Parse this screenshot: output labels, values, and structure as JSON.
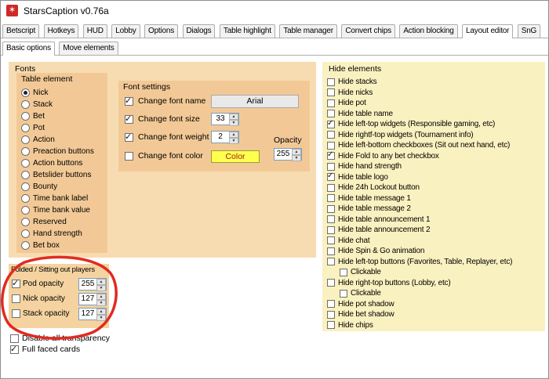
{
  "window": {
    "title": "StarsCaption v0.76a",
    "icon": "starscaption-logo"
  },
  "colors": {
    "panel_peach": "#f7dcb2",
    "group_peach": "#f2c996",
    "hide_panel_yellow": "#faf1c0",
    "annotation_red": "#e02b20",
    "color_button_yellow": "#ffff4d",
    "color_button_text": "#a02020",
    "app_icon_red": "#cf2a27"
  },
  "tabs": {
    "items": [
      {
        "label": "Betscript"
      },
      {
        "label": "Hotkeys"
      },
      {
        "label": "HUD"
      },
      {
        "label": "Lobby"
      },
      {
        "label": "Options"
      },
      {
        "label": "Dialogs"
      },
      {
        "label": "Table highlight"
      },
      {
        "label": "Table manager"
      },
      {
        "label": "Convert chips"
      },
      {
        "label": "Action blocking"
      },
      {
        "label": "Layout editor",
        "active": true
      },
      {
        "label": "SnG"
      }
    ]
  },
  "subtabs": {
    "items": [
      {
        "label": "Basic options",
        "active": true
      },
      {
        "label": "Move elements"
      }
    ]
  },
  "fonts": {
    "title": "Fonts",
    "table_element": {
      "title": "Table element",
      "options": [
        {
          "label": "Nick",
          "selected": true
        },
        {
          "label": "Stack"
        },
        {
          "label": "Bet"
        },
        {
          "label": "Pot"
        },
        {
          "label": "Action"
        },
        {
          "label": "Preaction buttons"
        },
        {
          "label": "Action buttons"
        },
        {
          "label": "Betslider buttons"
        },
        {
          "label": "Bounty"
        },
        {
          "label": "Time bank label"
        },
        {
          "label": "Time bank value"
        },
        {
          "label": "Reserved"
        },
        {
          "label": "Hand strength"
        },
        {
          "label": "Bet box"
        }
      ]
    },
    "font_settings": {
      "title": "Font settings",
      "change_font_name": {
        "label": "Change font name",
        "checked": true,
        "value": "Arial"
      },
      "change_font_size": {
        "label": "Change font size",
        "checked": true,
        "value": "33"
      },
      "change_font_weight": {
        "label": "Change font weight",
        "checked": true,
        "value": "2"
      },
      "change_font_color": {
        "label": "Change font color",
        "checked": false,
        "button": "Color"
      },
      "opacity_label": "Opacity",
      "opacity_value": "255"
    }
  },
  "folded_group": {
    "title": "Folded / Sitting out players",
    "rows": [
      {
        "label": "Pod opacity",
        "checked": true,
        "value": "255"
      },
      {
        "label": "Nick opacity",
        "checked": false,
        "value": "127"
      },
      {
        "label": "Stack opacity",
        "checked": false,
        "value": "127"
      }
    ]
  },
  "bottom_checkboxes": {
    "items": [
      {
        "label": "Disable all transparency",
        "checked": false
      },
      {
        "label": "Full faced cards",
        "checked": true
      }
    ]
  },
  "hide_elements": {
    "title": "Hide elements",
    "items": [
      {
        "label": "Hide stacks"
      },
      {
        "label": "Hide nicks"
      },
      {
        "label": "Hide pot"
      },
      {
        "label": "Hide table name"
      },
      {
        "label": "Hide left-top widgets (Responsible gaming, etc)",
        "checked": true
      },
      {
        "label": "Hide rightf-top widgets (Tournament info)"
      },
      {
        "label": "Hide left-bottom checkboxes (Sit out next hand, etc)"
      },
      {
        "label": "Hide Fold to any bet checkbox",
        "checked": true
      },
      {
        "label": "Hide hand strength"
      },
      {
        "label": "Hide table logo",
        "checked": true
      },
      {
        "label": "Hide 24h Lockout button"
      },
      {
        "label": "Hide table message 1"
      },
      {
        "label": "Hide table message 2"
      },
      {
        "label": "Hide table announcement 1"
      },
      {
        "label": "Hide table announcement 2"
      },
      {
        "label": "Hide chat"
      },
      {
        "label": "Hide Spin & Go animation"
      },
      {
        "label": "Hide left-top buttons (Favorites, Table, Replayer, etc)"
      },
      {
        "label": "Clickable",
        "indent": true
      },
      {
        "label": "Hide right-top buttons (Lobby, etc)"
      },
      {
        "label": "Clickable",
        "indent": true
      },
      {
        "label": "Hide pot shadow"
      },
      {
        "label": "Hide bet shadow"
      },
      {
        "label": "Hide chips"
      }
    ]
  }
}
